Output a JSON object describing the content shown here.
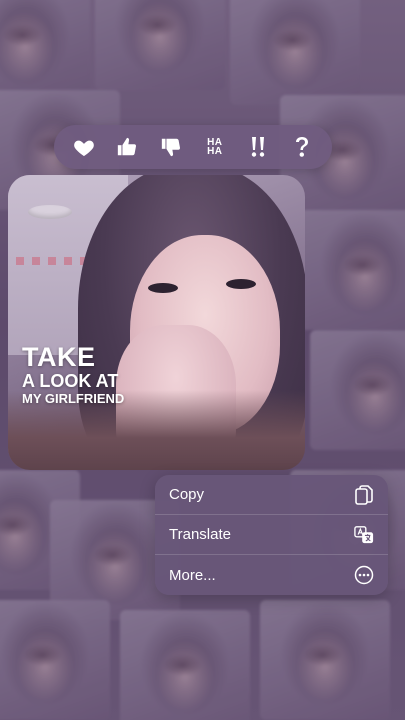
{
  "reactions": [
    {
      "name": "heart-icon",
      "label": ""
    },
    {
      "name": "thumbs-up-icon",
      "label": ""
    },
    {
      "name": "thumbs-down-icon",
      "label": ""
    },
    {
      "name": "haha-icon",
      "label": "HA HA"
    },
    {
      "name": "double-exclamation-icon",
      "label": ""
    },
    {
      "name": "question-mark-icon",
      "label": ""
    }
  ],
  "photo": {
    "caption_line1": "TAKE",
    "caption_line2": "A LOOK AT",
    "caption_line3": "MY GIRLFRIEND"
  },
  "menu": {
    "items": [
      {
        "label": "Copy",
        "icon": "copy-icon"
      },
      {
        "label": "Translate",
        "icon": "translate-icon"
      },
      {
        "label": "More...",
        "icon": "more-icon"
      }
    ]
  },
  "colors": {
    "menu_bg": "#685679",
    "reaction_bar_bg": "#705c80",
    "icon": "#ffffff"
  }
}
